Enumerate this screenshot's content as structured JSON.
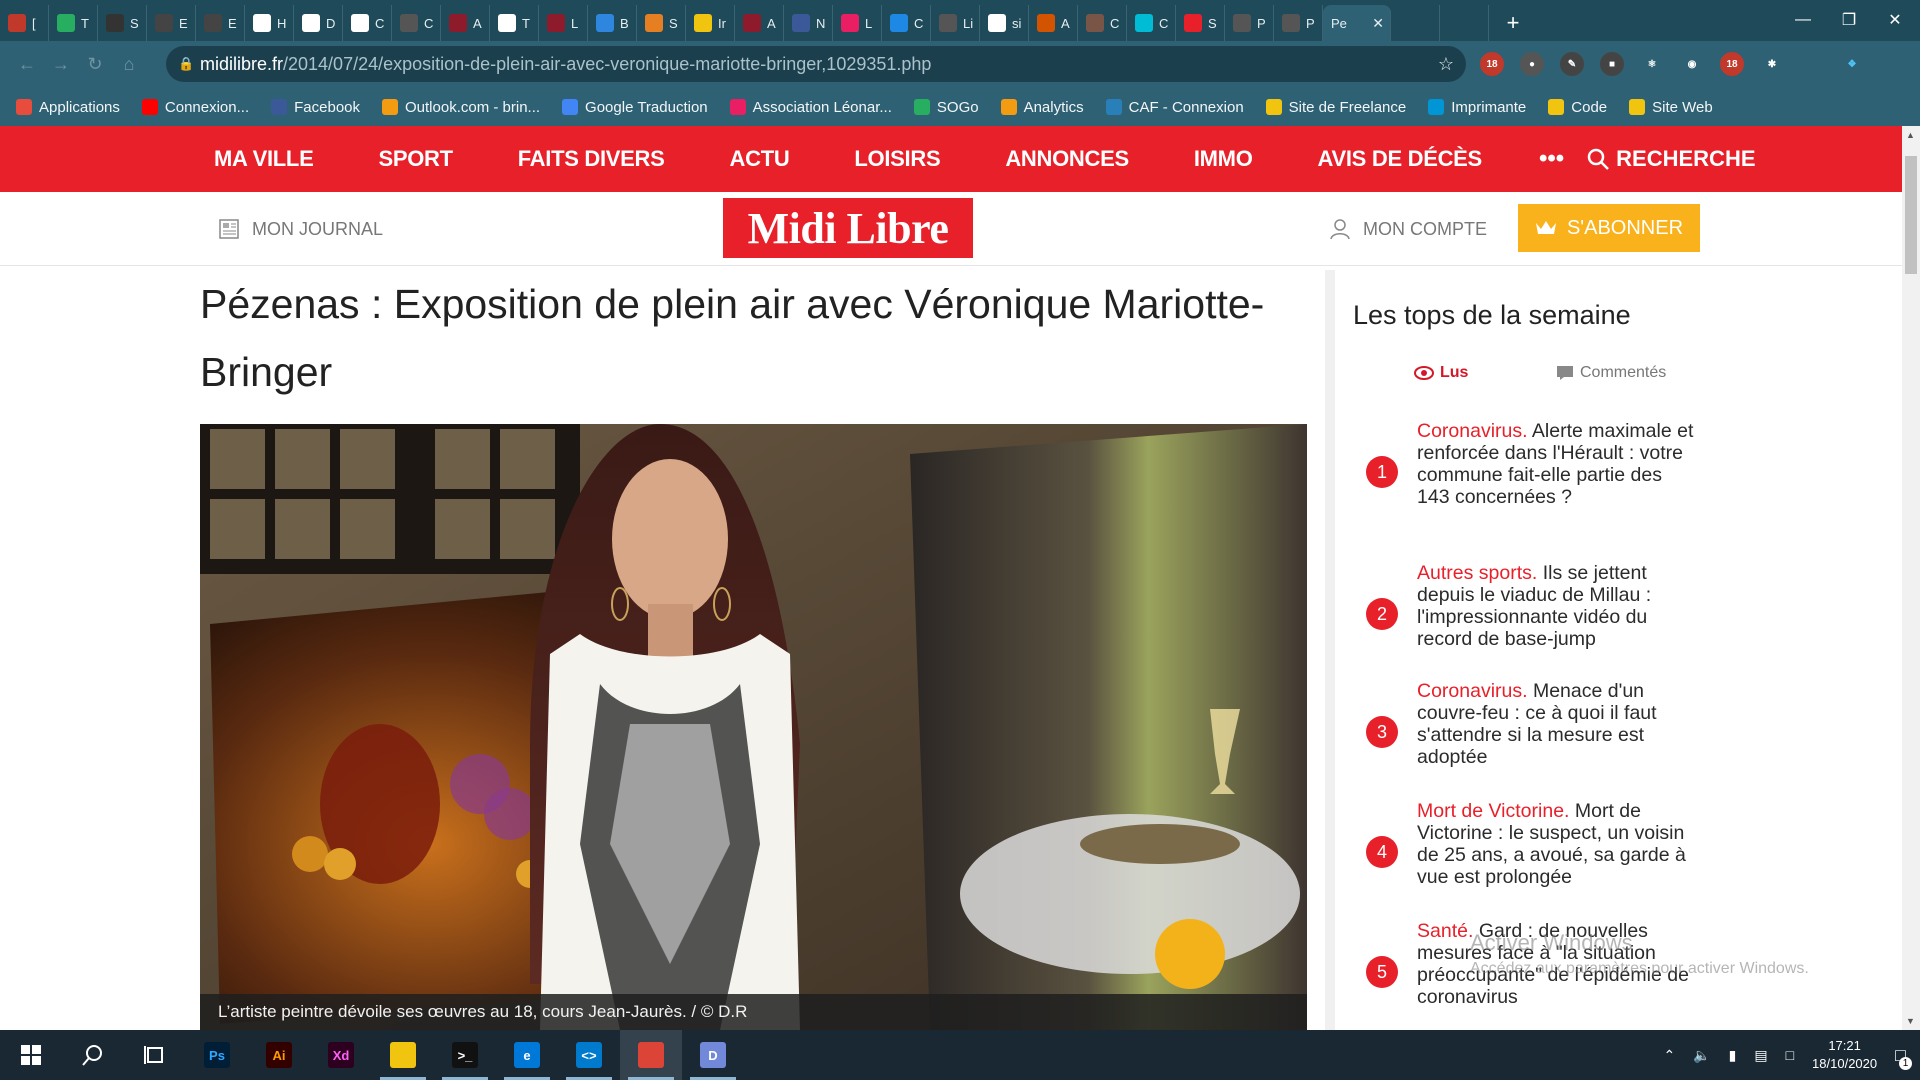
{
  "browser": {
    "tabs": [
      {
        "label": "[",
        "color": "#c0392b"
      },
      {
        "label": "T",
        "color": "#27ae60"
      },
      {
        "label": "S",
        "color": "#333333"
      },
      {
        "label": "E",
        "color": "#444444"
      },
      {
        "label": "E",
        "color": "#444444"
      },
      {
        "label": "H",
        "color": "#ffffff"
      },
      {
        "label": "D",
        "color": "#ffffff"
      },
      {
        "label": "C",
        "color": "#ffffff"
      },
      {
        "label": "C",
        "color": "#555555"
      },
      {
        "label": "A",
        "color": "#8e1b2b"
      },
      {
        "label": "T",
        "color": "#ffffff"
      },
      {
        "label": "L",
        "color": "#8e1b2b"
      },
      {
        "label": "B",
        "color": "#2e86de"
      },
      {
        "label": "S",
        "color": "#e67e22"
      },
      {
        "label": "Ir",
        "color": "#f1c40f"
      },
      {
        "label": "A",
        "color": "#8e1b2b"
      },
      {
        "label": "N",
        "color": "#3b5998"
      },
      {
        "label": "L",
        "color": "#e91e63"
      },
      {
        "label": "C",
        "color": "#1e88e5"
      },
      {
        "label": "Li",
        "color": "#555555"
      },
      {
        "label": "si",
        "color": "#ffffff"
      },
      {
        "label": "A",
        "color": "#d35400"
      },
      {
        "label": "C",
        "color": "#795548"
      },
      {
        "label": "C",
        "color": "#00bcd4"
      },
      {
        "label": "S",
        "color": "#e8202a"
      },
      {
        "label": "P",
        "color": "#555555"
      },
      {
        "label": "P",
        "color": "#555555"
      }
    ],
    "active_tab": {
      "label": "Pe",
      "close": "✕"
    },
    "new_tab": "+",
    "url_domain": "midilibre.fr",
    "url_path": "/2014/07/24/exposition-de-plein-air-avec-veronique-mariotte-bringer,1029351.php",
    "bookmarks": [
      {
        "label": "Applications",
        "color": "#e74c3c"
      },
      {
        "label": "Connexion...",
        "color": "#ff0000"
      },
      {
        "label": "Facebook",
        "color": "#3b5998"
      },
      {
        "label": "Outlook.com - brin...",
        "color": "#f39c12"
      },
      {
        "label": "Google Traduction",
        "color": "#4285f4"
      },
      {
        "label": "Association Léonar...",
        "color": "#e91e63"
      },
      {
        "label": "SOGo",
        "color": "#27ae60"
      },
      {
        "label": "Analytics",
        "color": "#f39c12"
      },
      {
        "label": "CAF - Connexion",
        "color": "#2980b9"
      },
      {
        "label": "Site de Freelance",
        "color": "#f1c40f"
      },
      {
        "label": "Imprimante",
        "color": "#0096d6"
      },
      {
        "label": "Code",
        "color": "#f1c40f"
      },
      {
        "label": "Site Web",
        "color": "#f1c40f"
      }
    ],
    "ext_badges": [
      "18",
      "18"
    ]
  },
  "site": {
    "nav": [
      "MA VILLE",
      "SPORT",
      "FAITS DIVERS",
      "ACTU",
      "LOISIRS",
      "ANNONCES",
      "IMMO",
      "AVIS DE DÉCÈS"
    ],
    "nav_more": "•••",
    "search": "RECHERCHE",
    "my_journal": "MON JOURNAL",
    "logo": "Midi Libre",
    "account": "MON COMPTE",
    "subscribe": "S'ABONNER",
    "brand_color": "#e8202a",
    "subscribe_color": "#f9b21b"
  },
  "article": {
    "title": "Pézenas : Exposition de plein air avec Véronique Mariotte-Bringer",
    "caption": "L’artiste peintre dévoile ses œuvres au 18, cours Jean-Jaurès.  / © D.R"
  },
  "sidebar": {
    "title": "Les tops de la semaine",
    "tab_read": "Lus",
    "tab_commented": "Commentés",
    "items": [
      {
        "num": "1",
        "category": "Coronavirus.",
        "text": "Alerte maximale et renforcée dans l'Hérault : votre commune fait-elle partie des 143 concernées ?"
      },
      {
        "num": "2",
        "category": "Autres sports.",
        "text": "Ils se jettent depuis le viaduc de Millau : l'impressionnante vidéo du record de base-jump"
      },
      {
        "num": "3",
        "category": "Coronavirus.",
        "text": "Menace d'un couvre-feu : ce à quoi il faut s'attendre si la mesure est adoptée"
      },
      {
        "num": "4",
        "category": "Mort de Victorine.",
        "text": "Mort de Victorine : le suspect, un voisin de 25 ans, a avoué, sa garde à vue est prolongée"
      },
      {
        "num": "5",
        "category": "Santé.",
        "text": "Gard : de nouvelles mesures face à \"la situation préoccupante\" de l'épidémie de coronavirus"
      }
    ]
  },
  "watermark": {
    "line1": "Activer Windows",
    "line2": "Accédez aux paramètres pour activer Windows."
  },
  "taskbar": {
    "apps": [
      {
        "name": "Ps",
        "color": "#001e36",
        "fg": "#31a8ff"
      },
      {
        "name": "Ai",
        "color": "#330000",
        "fg": "#ff9a00"
      },
      {
        "name": "Xd",
        "color": "#2e001f",
        "fg": "#ff61f6"
      },
      {
        "name": "",
        "color": "#f1c40f",
        "fg": "#fff"
      },
      {
        "name": ">_",
        "color": "#111111",
        "fg": "#fff"
      },
      {
        "name": "e",
        "color": "#0078d7",
        "fg": "#fff"
      },
      {
        "name": "<>",
        "color": "#007acc",
        "fg": "#fff"
      },
      {
        "name": "",
        "color": "#db4437",
        "fg": "#fff"
      },
      {
        "name": "D",
        "color": "#7289da",
        "fg": "#fff"
      }
    ],
    "time": "17:21",
    "date": "18/10/2020",
    "notif_count": "1"
  }
}
